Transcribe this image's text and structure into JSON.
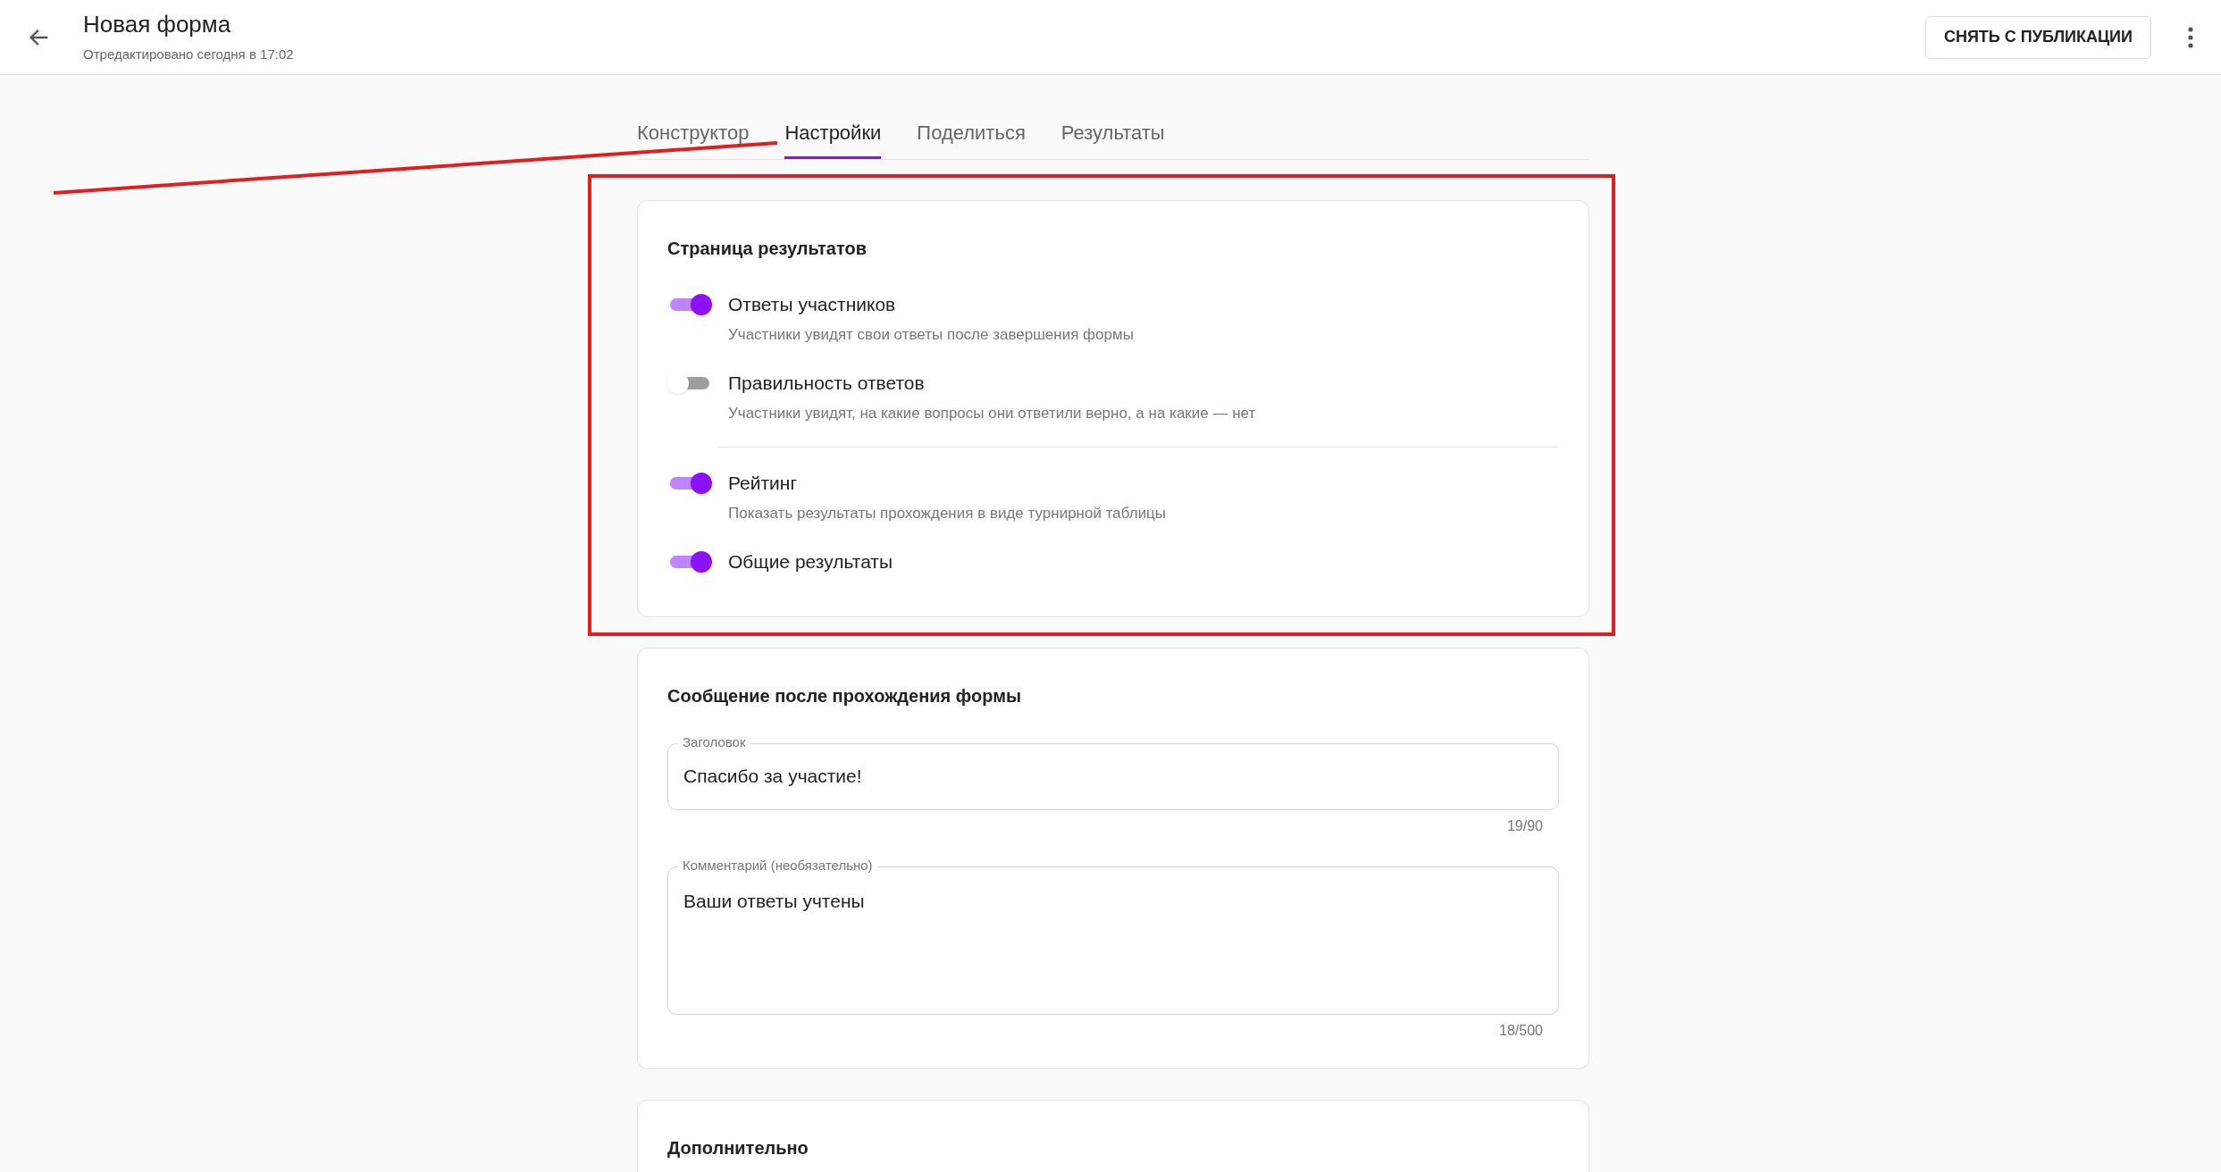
{
  "header": {
    "title": "Новая форма",
    "subtitle": "Отредактировано сегодня в 17:02",
    "action": "СНЯТЬ С ПУБЛИКАЦИИ"
  },
  "tabs": [
    {
      "label": "Конструктор",
      "selected": false
    },
    {
      "label": "Настройки",
      "selected": true
    },
    {
      "label": "Поделиться",
      "selected": false
    },
    {
      "label": "Результаты",
      "selected": false
    }
  ],
  "results_card": {
    "heading": "Страница результатов",
    "groups": [
      {
        "toggles": [
          {
            "label": "Ответы участников",
            "description": "Участники увидят свои ответы после завершения формы",
            "on": true
          },
          {
            "label": "Правильность ответов",
            "description": "Участники увидят, на какие вопросы они ответили верно, а на какие — нет",
            "on": false
          }
        ]
      },
      {
        "toggles": [
          {
            "label": "Рейтинг",
            "description": "Показать результаты прохождения в виде турнирной таблицы",
            "on": true
          },
          {
            "label": "Общие результаты",
            "on": true
          }
        ]
      }
    ]
  },
  "message_card": {
    "heading": "Сообщение после прохождения формы",
    "fields": [
      {
        "kind": "input",
        "label": "Заголовок",
        "value": "Спасибо за участие!",
        "counter": "19/90"
      },
      {
        "kind": "textarea",
        "label": "Комментарий (необязательно)",
        "value": "Ваши ответы учтены",
        "counter": "18/500"
      }
    ]
  },
  "extra_card": {
    "heading": "Дополнительно"
  }
}
